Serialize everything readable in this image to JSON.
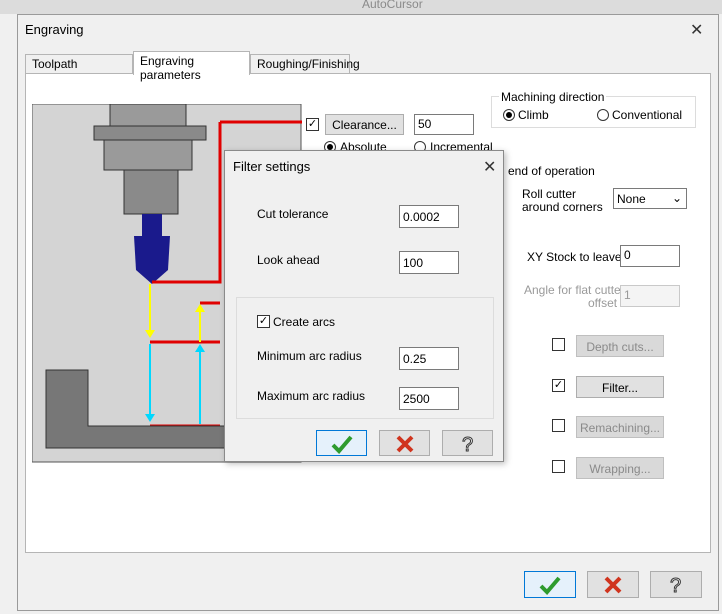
{
  "window": {
    "title": "Engraving",
    "close_glyph": "✕",
    "background_text": "AutoCursor"
  },
  "tabs": [
    "Toolpath parameters",
    "Engraving parameters",
    "Roughing/Finishing"
  ],
  "clearance": {
    "button_label": "Clearance...",
    "value": "50",
    "checked": true
  },
  "clearance_mode": {
    "absolute": "Absolute",
    "incremental": "Incremental",
    "selected": "Absolute"
  },
  "machining_direction": {
    "legend": "Machining direction",
    "climb": "Climb",
    "conventional": "Conventional",
    "selected": "Climb"
  },
  "end_of_operation_label": "end of operation",
  "roll_cutter": {
    "label_line1": "Roll cutter",
    "label_line2": "around corners",
    "value": "None"
  },
  "xy_stock": {
    "label": "XY Stock to leave",
    "value": "0"
  },
  "angle_flat": {
    "label_line1": "Angle for flat cutter",
    "label_line2": "offset",
    "value": "1"
  },
  "option_buttons": {
    "depth_cuts": "Depth cuts...",
    "filter": "Filter...",
    "remachining": "Remachining...",
    "wrapping": "Wrapping..."
  },
  "option_checks": {
    "depth_cuts": false,
    "filter": true,
    "remachining": false,
    "wrapping": false
  },
  "filter_dialog": {
    "title": "Filter settings",
    "close_glyph": "✕",
    "cut_tolerance_label": "Cut tolerance",
    "cut_tolerance": "0.0002",
    "look_ahead_label": "Look ahead",
    "look_ahead": "100",
    "create_arcs_label": "Create arcs",
    "create_arcs": true,
    "min_arc_label": "Minimum arc radius",
    "min_arc": "0.25",
    "max_arc_label": "Maximum arc radius",
    "max_arc": "2500"
  },
  "icons": {
    "ok": "check-icon",
    "cancel": "x-icon",
    "help": "question-icon"
  },
  "colors": {
    "ok_green": "#2e9b2e",
    "cancel_red": "#d0341e",
    "accent": "#0078d7",
    "path_red": "#e00000",
    "yellow": "#ffff00",
    "cyan": "#00d8ff",
    "tool_blue": "#1a1a8c"
  }
}
